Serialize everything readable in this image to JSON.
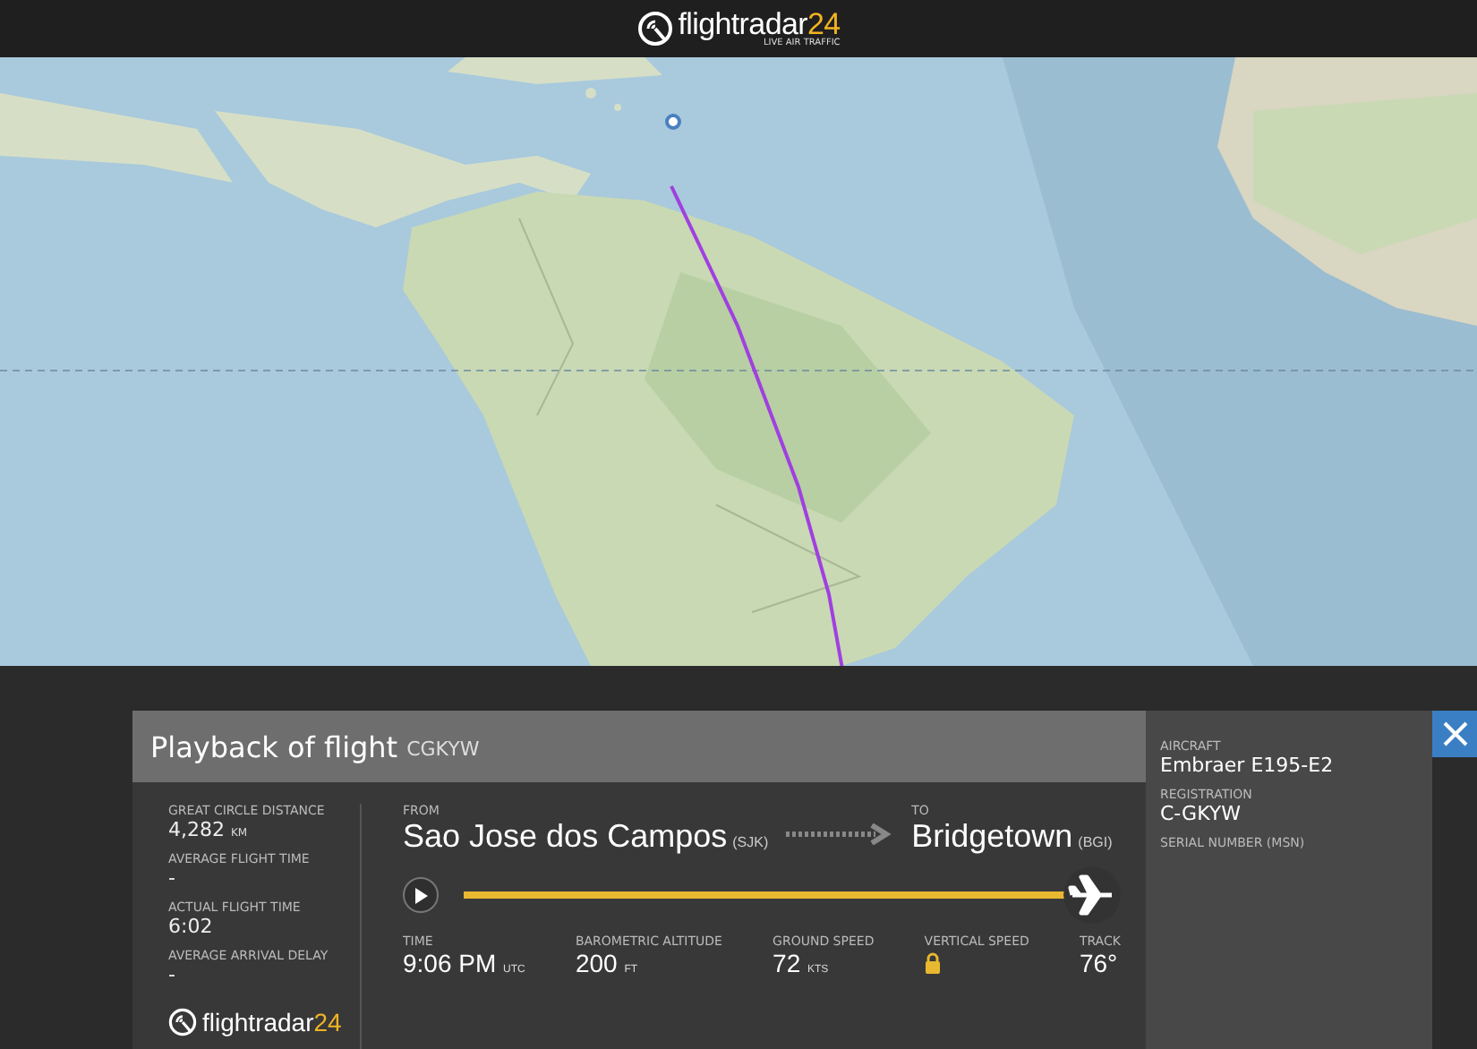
{
  "header": {
    "logo": {
      "name": "flightradar",
      "accent": "24",
      "tagline": "LIVE AIR TRAFFIC"
    }
  },
  "playback": {
    "title": "Playback of flight",
    "callsign": "CGKYW",
    "stats": [
      {
        "label": "GREAT CIRCLE DISTANCE",
        "value": "4,282",
        "unit": "KM"
      },
      {
        "label": "AVERAGE FLIGHT TIME",
        "value": "-"
      },
      {
        "label": "ACTUAL FLIGHT TIME",
        "value": "6:02"
      },
      {
        "label": "AVERAGE ARRIVAL DELAY",
        "value": "-"
      }
    ],
    "from": {
      "label": "FROM",
      "city": "Sao Jose dos Campos",
      "code": "(SJK)"
    },
    "to": {
      "label": "TO",
      "city": "Bridgetown",
      "code": "(BGI)"
    },
    "progress": {
      "level": 1
    },
    "telemetry": [
      {
        "kind": "value",
        "label": "TIME",
        "value": "9:06 PM",
        "unit": "UTC"
      },
      {
        "kind": "value",
        "label": "BAROMETRIC ALTITUDE",
        "value": "200",
        "unit": "FT"
      },
      {
        "kind": "value",
        "label": "GROUND SPEED",
        "value": "72",
        "unit": "KTS"
      },
      {
        "kind": "locked",
        "label": "VERTICAL SPEED"
      },
      {
        "kind": "value",
        "label": "TRACK",
        "value": "76°"
      }
    ],
    "footer_logo": {
      "name": "flightradar",
      "accent": "24"
    }
  },
  "aircraft": {
    "fields": [
      {
        "label": "AIRCRAFT",
        "value": "Embraer E195-E2"
      },
      {
        "label": "REGISTRATION",
        "value": "C-GKYW"
      },
      {
        "label": "SERIAL NUMBER (MSN)"
      }
    ]
  }
}
